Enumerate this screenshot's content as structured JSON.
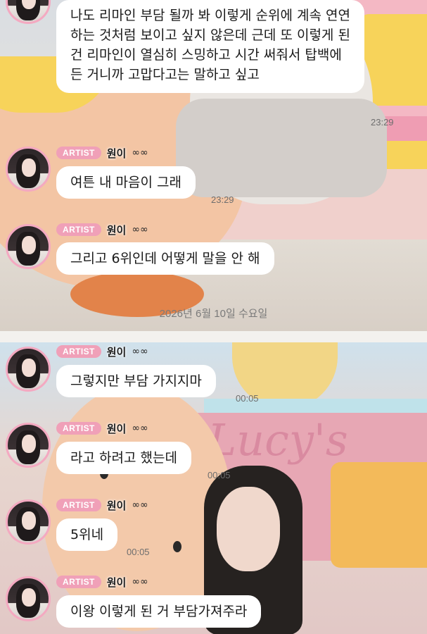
{
  "sender": {
    "badge": "ARTIST",
    "name": "원이",
    "name_icon": "infinity-icon",
    "name_symbol": "∞∞"
  },
  "colors": {
    "badge": "#f0a0b8",
    "avatar_ring": "#f4a9c1",
    "bubble": "#ffffff"
  },
  "messages": [
    {
      "text": "나도 리마인 부담 될까 봐 이렇게 순위에 계속 연연하는 것처럼 보이고 싶지 않은데 근데 또 이렇게 된 건 리마인이 열심히 스밍하고 시간 써줘서 탑백에 든 거니까 고맙다고는 말하고 싶고",
      "time": "23:29"
    },
    {
      "text": "여튼 내 마음이 그래",
      "time": "23:29"
    },
    {
      "text": "그리고 6위인데 어떻게 말을 안 해",
      "time": ""
    }
  ],
  "date_divider": "2026년 6월 10일 수요일",
  "messages_after": [
    {
      "text": "그렇지만 부담 가지지마",
      "time": "00:05"
    },
    {
      "text": "라고 하려고 했는데",
      "time": "00:05"
    },
    {
      "text": "5위네",
      "time": "00:05"
    },
    {
      "text": "이왕 이렇게 된 거 부담가져주라",
      "time": ""
    }
  ]
}
